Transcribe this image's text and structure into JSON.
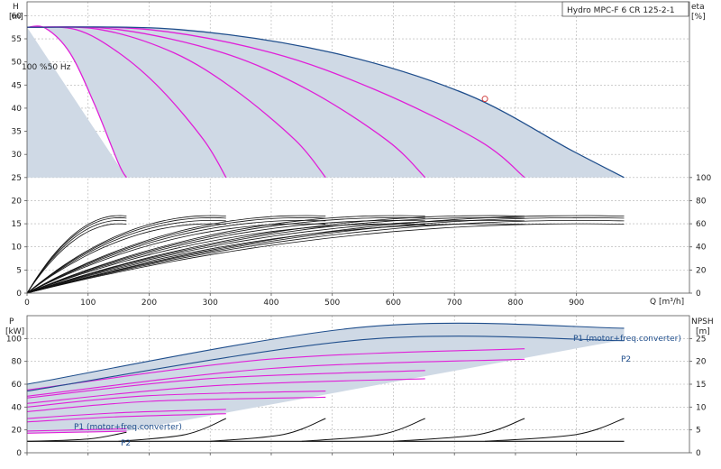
{
  "chart_data": [
    {
      "type": "line",
      "name": "Q-H / efficiency",
      "product_label": "Hydro MPC-F 6 CR 125-2-1",
      "speed_label": "100 %50 Hz",
      "y_left_label": "H",
      "y_left_unit": "[m]",
      "y_right_label": "eta",
      "y_right_unit": "[%]",
      "x_label": "Q [m³/h]",
      "x_ticks": [
        "0",
        "100",
        "200",
        "300",
        "400",
        "500",
        "600",
        "700",
        "800",
        "900"
      ],
      "y_left_ticks": [
        "0",
        "5",
        "10",
        "15",
        "20",
        "25",
        "30",
        "35",
        "40",
        "45",
        "50",
        "55",
        "60"
      ],
      "y_right_ticks": [
        "0",
        "20",
        "40",
        "60",
        "80",
        "100"
      ],
      "xlim": [
        0,
        1085
      ],
      "ylim_left": [
        0,
        63
      ],
      "ylim_right": [
        0,
        100
      ],
      "grid": true,
      "duty_point": {
        "x": 750,
        "y": 42
      },
      "series": [
        {
          "values": [
            [
              0,
              57.5
            ],
            [
              30,
              57.3
            ],
            [
              70,
              52
            ],
            [
              110,
              41
            ],
            [
              150,
              28
            ],
            [
              163,
              25
            ]
          ]
        },
        {
          "values": [
            [
              0,
              57.5
            ],
            [
              80,
              57
            ],
            [
              150,
              52
            ],
            [
              220,
              44
            ],
            [
              290,
              33
            ],
            [
              326,
              25
            ]
          ]
        },
        {
          "values": [
            [
              0,
              57.5
            ],
            [
              120,
              57
            ],
            [
              240,
              52
            ],
            [
              340,
              44
            ],
            [
              440,
              33
            ],
            [
              489,
              25
            ]
          ]
        },
        {
          "values": [
            [
              0,
              57.5
            ],
            [
              150,
              57
            ],
            [
              320,
              52
            ],
            [
              460,
              44
            ],
            [
              590,
              33
            ],
            [
              652,
              25
            ]
          ]
        },
        {
          "values": [
            [
              0,
              57.5
            ],
            [
              200,
              57
            ],
            [
              400,
              52
            ],
            [
              570,
              44
            ],
            [
              740,
              33
            ],
            [
              815,
              25
            ]
          ]
        },
        {
          "values": [
            [
              0,
              57.5
            ],
            [
              250,
              57
            ],
            [
              500,
              52
            ],
            [
              720,
              43
            ],
            [
              890,
              31
            ],
            [
              978,
              25
            ]
          ]
        }
      ]
    },
    {
      "type": "line",
      "name": "Power / NPSH",
      "y_left_label": "P",
      "y_left_unit": "[kW]",
      "y_right_label": "NPSH",
      "y_right_unit": "[m]",
      "x_ticks": [
        "0",
        "100",
        "200",
        "300",
        "400",
        "500",
        "600",
        "700",
        "800",
        "900"
      ],
      "y_left_ticks": [
        "0",
        "20",
        "40",
        "60",
        "80",
        "100"
      ],
      "y_right_ticks": [
        "0",
        "5",
        "10",
        "15",
        "20",
        "25"
      ],
      "xlim": [
        0,
        1085
      ],
      "ylim_left": [
        0,
        120
      ],
      "ylim_right": [
        0,
        30
      ],
      "grid": true,
      "p1_label": "P1 (motor+freq.converter)",
      "p2_label": "P2",
      "series": [
        {
          "values": [
            [
              0,
              19
            ],
            [
              80,
              20
            ],
            [
              163,
              21
            ]
          ]
        },
        {
          "values": [
            [
              0,
              30
            ],
            [
              150,
              35
            ],
            [
              326,
              38
            ]
          ]
        },
        {
          "values": [
            [
              0,
              40
            ],
            [
              200,
              50
            ],
            [
              489,
              54
            ]
          ]
        },
        {
          "values": [
            [
              0,
              48
            ],
            [
              300,
              65
            ],
            [
              652,
              72
            ]
          ]
        },
        {
          "values": [
            [
              0,
              55
            ],
            [
              400,
              82
            ],
            [
              815,
              91
            ]
          ]
        },
        {
          "values": [
            [
              0,
              60
            ],
            [
              550,
              110
            ],
            [
              978,
              109
            ]
          ]
        }
      ],
      "npsh_series": [
        {
          "values": [
            [
              0,
              2.5
            ],
            [
              100,
              3
            ],
            [
              163,
              4.5
            ]
          ]
        },
        {
          "values": [
            [
              150,
              2.5
            ],
            [
              260,
              4
            ],
            [
              326,
              7.5
            ]
          ]
        },
        {
          "values": [
            [
              300,
              2.5
            ],
            [
              420,
              4
            ],
            [
              489,
              7.5
            ]
          ]
        },
        {
          "values": [
            [
              450,
              2.5
            ],
            [
              580,
              4
            ],
            [
              652,
              7.5
            ]
          ]
        },
        {
          "values": [
            [
              600,
              2.5
            ],
            [
              740,
              4
            ],
            [
              815,
              7.5
            ]
          ]
        },
        {
          "values": [
            [
              750,
              2.5
            ],
            [
              900,
              4
            ],
            [
              978,
              7.5
            ]
          ]
        }
      ]
    }
  ]
}
